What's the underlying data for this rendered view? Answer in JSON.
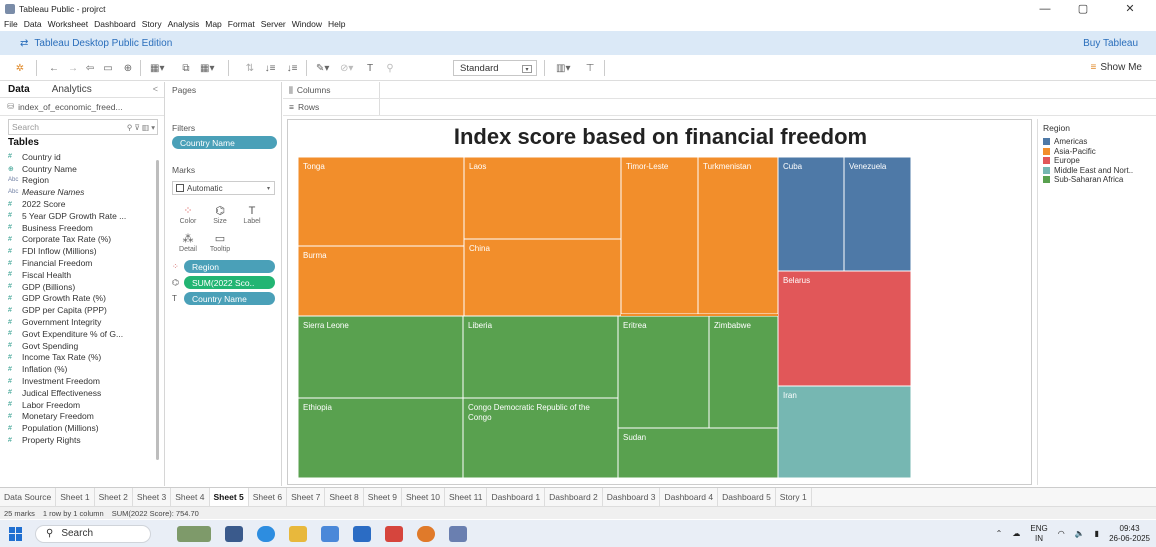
{
  "window": {
    "title": "Tableau Public - projrct",
    "minimize": "—",
    "maximize": "▢",
    "close": "✕"
  },
  "menu": [
    "File",
    "Data",
    "Worksheet",
    "Dashboard",
    "Story",
    "Analysis",
    "Map",
    "Format",
    "Server",
    "Window",
    "Help"
  ],
  "edition": {
    "label": "Tableau Desktop Public Edition",
    "buy": "Buy Tableau"
  },
  "toolbar": {
    "fit_select": "Standard",
    "show_me": "Show Me"
  },
  "left_pane": {
    "tab_data": "Data",
    "tab_analytics": "Analytics",
    "collapse": "<",
    "datasource": "index_of_economic_freed...",
    "search_placeholder": "Search",
    "tables_header": "Tables",
    "fields": [
      {
        "type": "#",
        "name": "Country id"
      },
      {
        "type": "⊕",
        "name": "Country Name"
      },
      {
        "type": "Abc",
        "name": "Region"
      },
      {
        "type": "Abc",
        "name": "Measure Names"
      },
      {
        "type": "#",
        "name": "2022 Score"
      },
      {
        "type": "#",
        "name": "5 Year GDP Growth Rate ..."
      },
      {
        "type": "#",
        "name": "Business Freedom"
      },
      {
        "type": "#",
        "name": "Corporate Tax Rate (%)"
      },
      {
        "type": "#",
        "name": "FDI Inflow (Millions)"
      },
      {
        "type": "#",
        "name": "Financial Freedom"
      },
      {
        "type": "#",
        "name": "Fiscal Health"
      },
      {
        "type": "#",
        "name": "GDP (Billions)"
      },
      {
        "type": "#",
        "name": "GDP Growth Rate (%)"
      },
      {
        "type": "#",
        "name": "GDP per Capita (PPP)"
      },
      {
        "type": "#",
        "name": "Government Integrity"
      },
      {
        "type": "#",
        "name": "Govt Expenditure % of G..."
      },
      {
        "type": "#",
        "name": "Govt Spending"
      },
      {
        "type": "#",
        "name": "Income Tax Rate (%)"
      },
      {
        "type": "#",
        "name": "Inflation (%)"
      },
      {
        "type": "#",
        "name": "Investment Freedom"
      },
      {
        "type": "#",
        "name": "Judical Effectiveness"
      },
      {
        "type": "#",
        "name": "Labor Freedom"
      },
      {
        "type": "#",
        "name": "Monetary Freedom"
      },
      {
        "type": "#",
        "name": "Population (Millions)"
      },
      {
        "type": "#",
        "name": "Property Rights"
      }
    ]
  },
  "mid_pane": {
    "pages": "Pages",
    "filters": "Filters",
    "filter_pill": "Country Name",
    "marks": "Marks",
    "mark_type": "Automatic",
    "cards": [
      "Color",
      "Size",
      "Label",
      "Detail",
      "Tooltip"
    ],
    "mark_pills": [
      "Region",
      "SUM(2022 Sco..",
      "Country Name"
    ]
  },
  "shelves": {
    "columns": "Columns",
    "rows": "Rows"
  },
  "viz": {
    "title": "Index score based on financial freedom"
  },
  "chart_data": {
    "type": "treemap",
    "title": "Index score based on financial freedom",
    "size_measure": "SUM(2022 Score)",
    "color_dimension": "Region",
    "total": 754.7,
    "marks_count": 25,
    "legend_title": "Region",
    "legend": [
      {
        "name": "Americas",
        "color": "#4e79a7"
      },
      {
        "name": "Asia-Pacific",
        "color": "#f28e2b"
      },
      {
        "name": "Europe",
        "color": "#e15759"
      },
      {
        "name": "Middle East and Nort..",
        "color": "#76b7b2"
      },
      {
        "name": "Sub-Saharan Africa",
        "color": "#59a14f"
      }
    ],
    "labeled_marks": [
      {
        "country": "Tonga",
        "region": "Asia-Pacific"
      },
      {
        "country": "Laos",
        "region": "Asia-Pacific"
      },
      {
        "country": "Timor-Leste",
        "region": "Asia-Pacific"
      },
      {
        "country": "Turkmenistan",
        "region": "Asia-Pacific"
      },
      {
        "country": "Burma",
        "region": "Asia-Pacific"
      },
      {
        "country": "China",
        "region": "Asia-Pacific"
      },
      {
        "country": "Cuba",
        "region": "Americas"
      },
      {
        "country": "Venezuela",
        "region": "Americas"
      },
      {
        "country": "Belarus",
        "region": "Europe"
      },
      {
        "country": "Iran",
        "region": "Middle East and Nort.."
      },
      {
        "country": "Sierra Leone",
        "region": "Sub-Saharan Africa"
      },
      {
        "country": "Liberia",
        "region": "Sub-Saharan Africa"
      },
      {
        "country": "Eritrea",
        "region": "Sub-Saharan Africa"
      },
      {
        "country": "Zimbabwe",
        "region": "Sub-Saharan Africa"
      },
      {
        "country": "Ethiopia",
        "region": "Sub-Saharan Africa"
      },
      {
        "country": "Congo Democratic Republic of the Congo",
        "region": "Sub-Saharan Africa"
      },
      {
        "country": "Sudan",
        "region": "Sub-Saharan Africa"
      }
    ]
  },
  "sheet_tabs": [
    "Data Source",
    "Sheet 1",
    "Sheet 2",
    "Sheet 3",
    "Sheet 4",
    "Sheet 5",
    "Sheet 6",
    "Sheet 7",
    "Sheet 8",
    "Sheet 9",
    "Sheet 10",
    "Sheet 11",
    "Dashboard 1",
    "Dashboard 2",
    "Dashboard 3",
    "Dashboard 4",
    "Dashboard 5",
    "Story 1"
  ],
  "active_sheet": "Sheet 5",
  "status": {
    "marks": "25 marks",
    "rows": "1 row by 1 column",
    "sum": "SUM(2022 Score): 754.70"
  },
  "taskbar": {
    "search": "Search",
    "lang_top": "ENG",
    "lang_bottom": "IN",
    "time": "09:43",
    "date": "26-06-2025"
  }
}
